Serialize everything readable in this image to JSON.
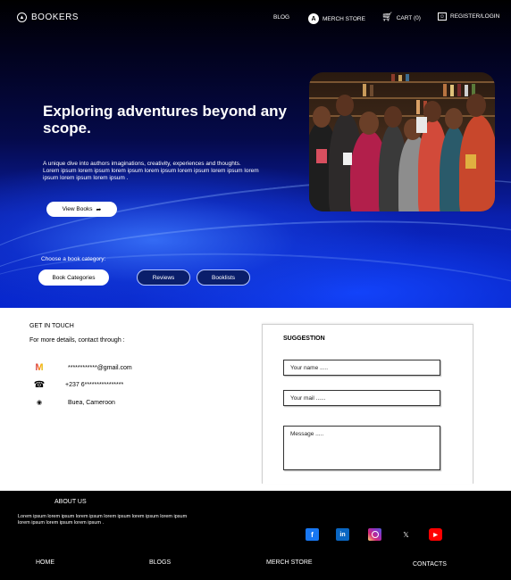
{
  "header": {
    "brand": "BOOKERS",
    "nav": {
      "blog": "BLOG",
      "merch_badge": "A",
      "merch": "MERCH STORE",
      "cart": "CART (0)",
      "register": "REGISTER/LOGIN"
    }
  },
  "hero": {
    "headline": "Exploring adventures beyond any scope.",
    "description": "A unique dive into authors imaginations, creativity, experiences and thoughts.\nLorem ipsum lorem ipsum lorem ipsum lorem ipsum lorem ipsum lorem ipsum lorem ipsum lorem ipsum lorem ipsum .",
    "view_books": "View Books",
    "choose_category": "Choose a book category:",
    "categories": [
      "Book Categories",
      "Reviews",
      "Booklists"
    ]
  },
  "contact": {
    "title": "GET IN TOUCH",
    "subtitle": "For more details, contact through :",
    "email": "************@gmail.com",
    "phone": "+237 6****************",
    "location": "Buea, Cameroon"
  },
  "suggestion": {
    "title": "SUGGESTION",
    "name_placeholder": "Your name .....",
    "mail_placeholder": "Your mail ......",
    "message_placeholder": "Message ....."
  },
  "footer": {
    "about_title": "ABOUT US",
    "about_text": "Lorem ipsum lorem ipsum lorem ipsum lorem ipsum lorem ipsum lorem ipsum lorem ipsum lorem ipsum lorem ipsum .",
    "social": [
      "facebook-icon",
      "linkedin-icon",
      "instagram-icon",
      "x-icon",
      "youtube-icon"
    ],
    "links": {
      "home": "HOME",
      "blogs": "BLOGS",
      "merch": "MERCH STORE",
      "contacts": "CONTACTS"
    }
  },
  "colors": {
    "hero_dark": "#000000",
    "hero_blue": "#0626d0",
    "footer_bg": "#000000",
    "facebook": "#1877f2",
    "linkedin": "#0a66c2",
    "youtube": "#ff0000"
  }
}
